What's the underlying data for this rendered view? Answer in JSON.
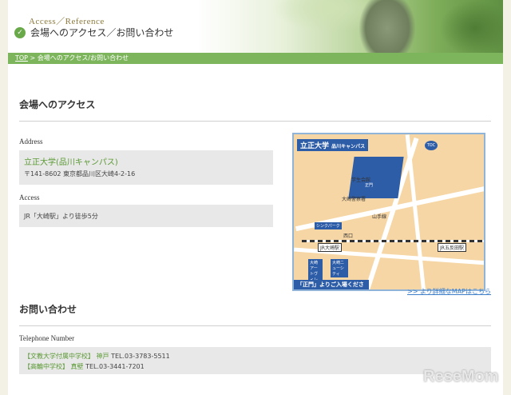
{
  "header": {
    "subtitle": "Access／Reference",
    "title": "会場へのアクセス／お問い合わせ"
  },
  "breadcrumb": {
    "top": "TOP",
    "sep": " > ",
    "current": "会場へのアクセス/お問い合わせ"
  },
  "access_section": {
    "heading": "会場へのアクセス",
    "address_label": "Address",
    "venue_name": "立正大学(品川キャンパス)",
    "address": "〒141-8602 東京都品川区大崎4-2-16",
    "access_label": "Access",
    "access_text": "JR「大崎駅」より徒歩5分",
    "map_link": ">> より詳細なMAPはこちら"
  },
  "map": {
    "title": "立正大学",
    "title_sub": "品川キャンパス",
    "gate": "正門",
    "station_osaki": "JR大崎駅",
    "station_gotanda": "JR五反田駅",
    "station_nishi": "西口",
    "note": "「正門」よりご入場ください",
    "toc": "TOC",
    "box_shinka": "シンクパーク",
    "box_osaki_newcity": "大崎ニューシティ",
    "box_artvillage": "大崎アートヴィレッジ",
    "label_gakusei": "学生会館",
    "label_yamanote": "山手線",
    "label_osakikeisatsu": "大崎警察署"
  },
  "contact_section": {
    "heading": "お問い合わせ",
    "tel_label": "Telephone Number",
    "line1_school": "【文教大学付属中学校】",
    "line1_person": "神戸",
    "line1_tel": "TEL.03-3783-5511",
    "line2_school": "【高輪中学校】",
    "line2_person": "真壁",
    "line2_tel": "TEL.03-3441-7201"
  },
  "watermark": "ReseMom"
}
